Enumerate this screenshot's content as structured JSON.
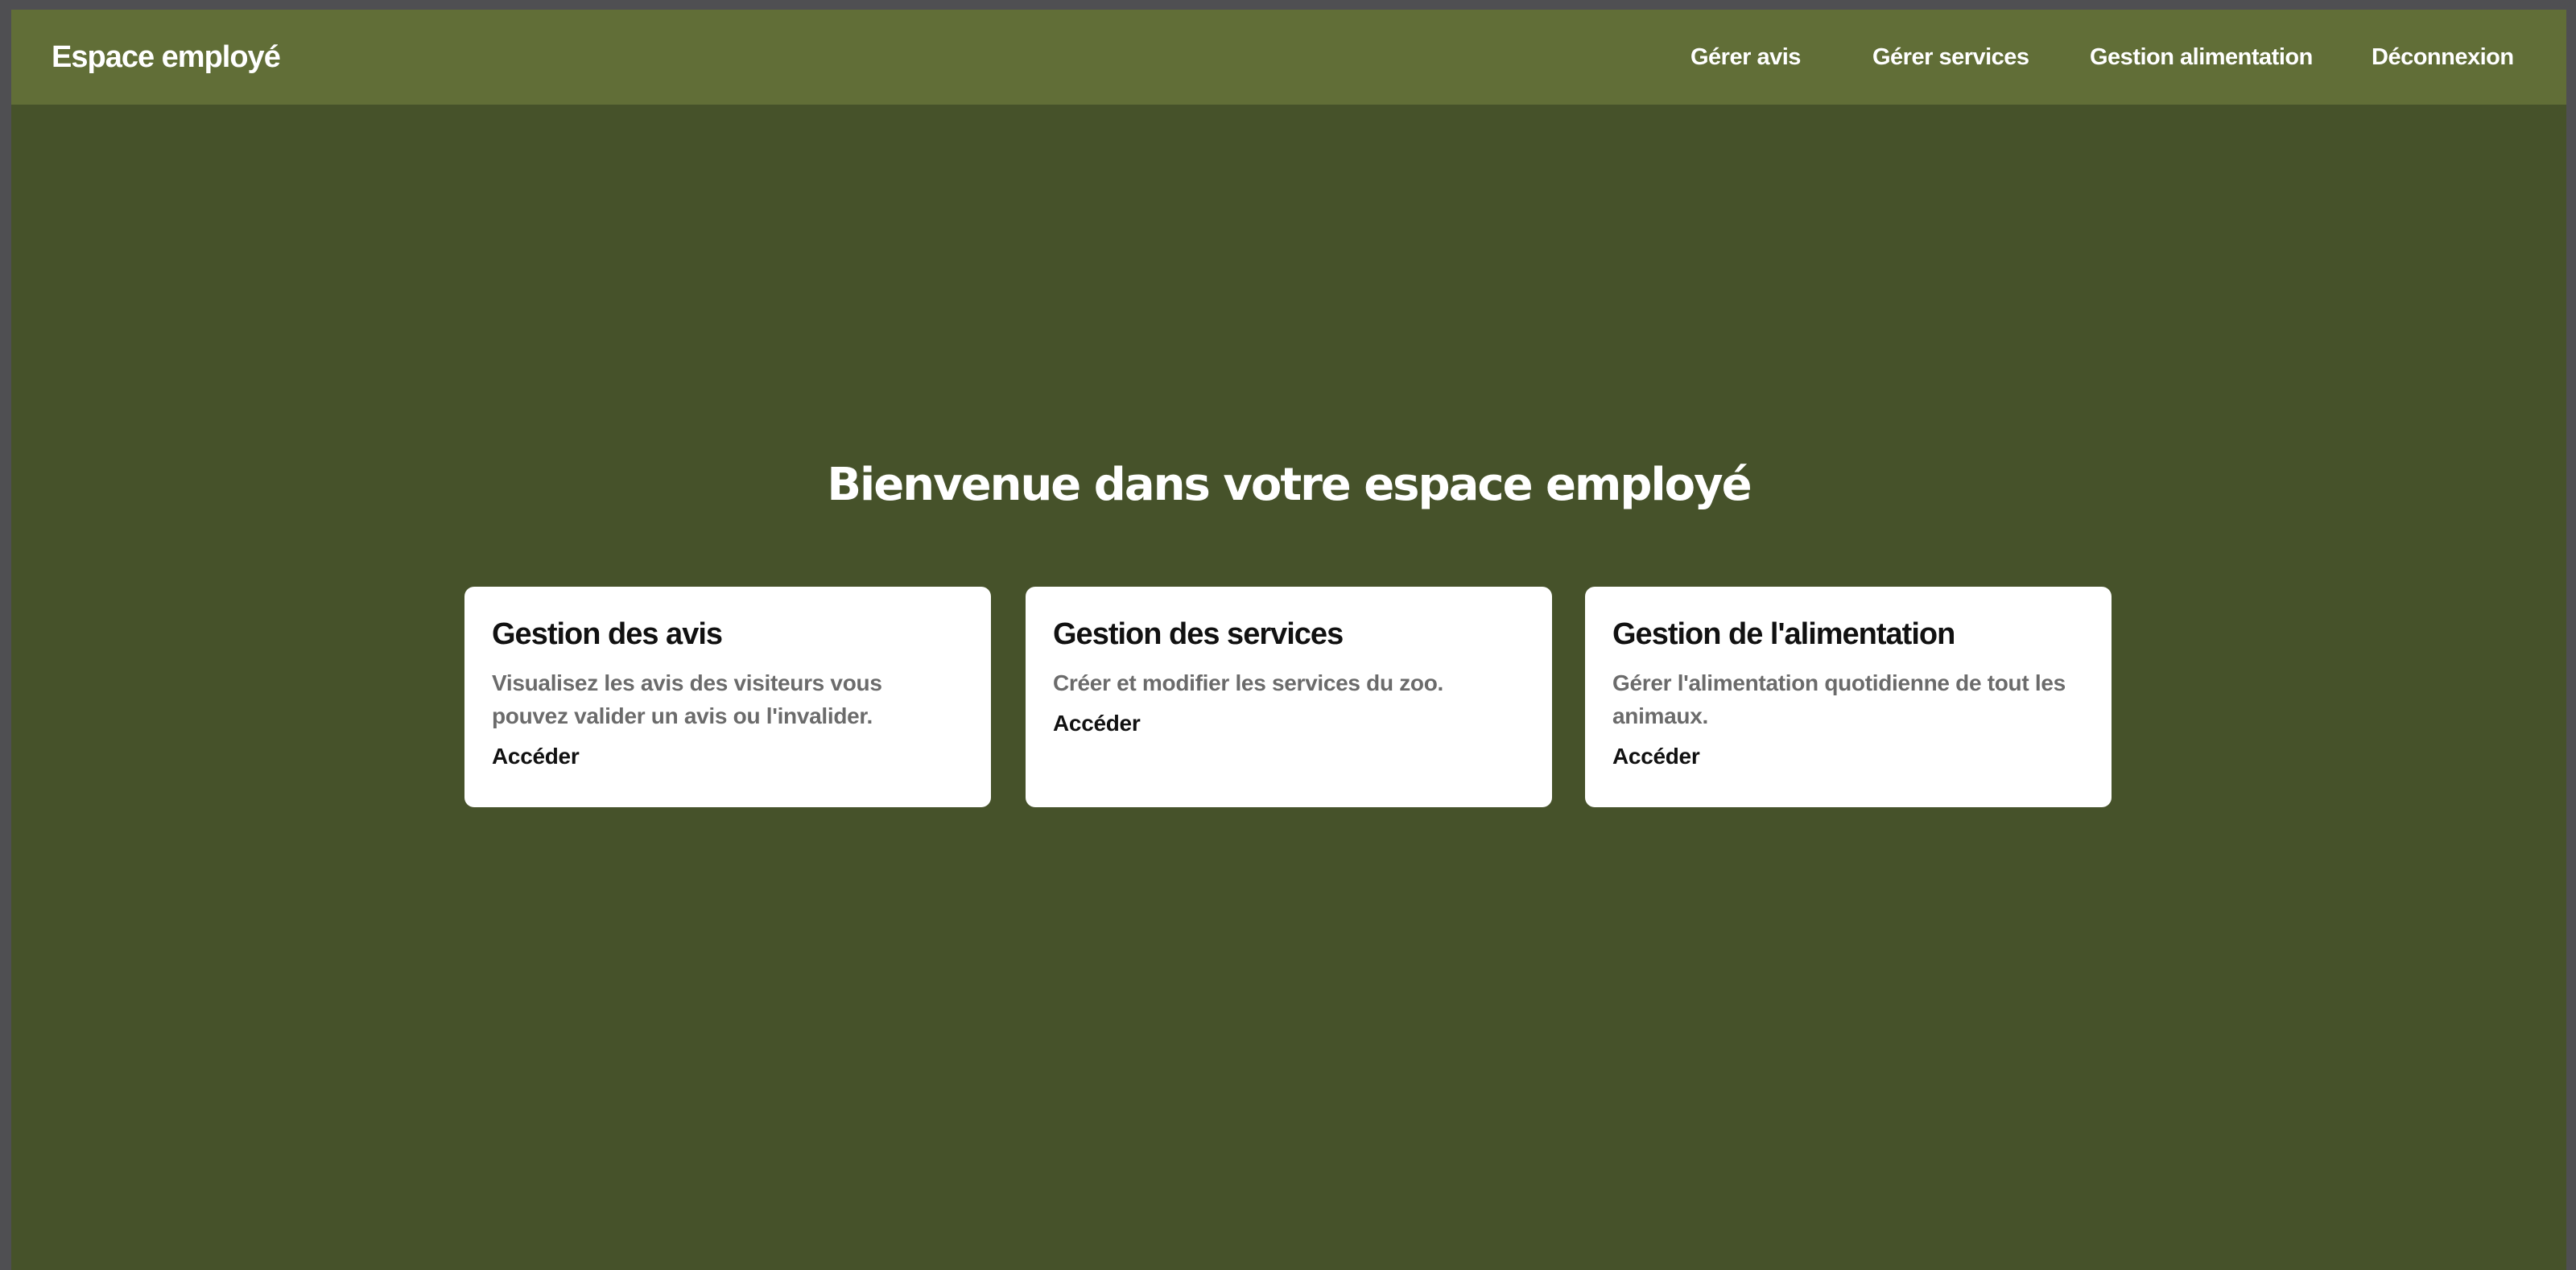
{
  "navbar": {
    "brand": "Espace employé",
    "links": [
      {
        "label": "Gérer avis"
      },
      {
        "label": "Gérer services"
      },
      {
        "label": "Gestion alimentation"
      },
      {
        "label": "Déconnexion"
      }
    ]
  },
  "main": {
    "title": "Bienvenue dans votre espace employé",
    "cards": [
      {
        "title": "Gestion des avis",
        "description": "Visualisez les avis des visiteurs vous pouvez valider un avis ou l'invalider.",
        "link": "Accéder"
      },
      {
        "title": "Gestion des services",
        "description": "Créer et modifier les services du zoo.",
        "link": "Accéder"
      },
      {
        "title": "Gestion de l'alimentation",
        "description": "Gérer l'alimentation quotidienne de tout les animaux.",
        "link": "Accéder"
      }
    ]
  },
  "colors": {
    "navbar_bg": "#616e37",
    "page_bg": "#46522a",
    "card_bg": "#ffffff"
  }
}
